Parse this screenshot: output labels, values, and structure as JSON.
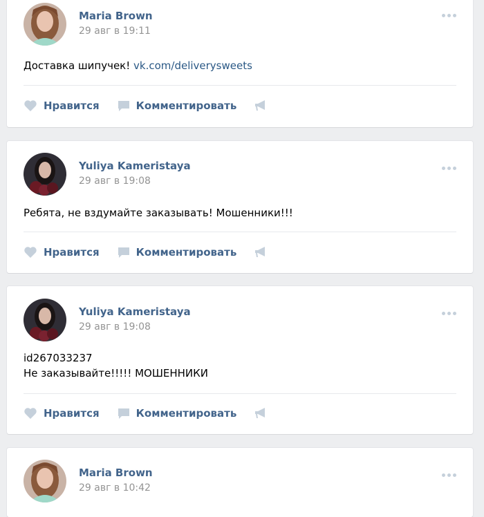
{
  "posts": [
    {
      "author": "Maria Brown",
      "date": "29 авг в 19:11",
      "text_lines": [
        "Доставка шипучек! "
      ],
      "link": "vk.com/deliverysweets",
      "avatar": "woman-blonde",
      "like_label": "Нравится",
      "comment_label": "Комментировать"
    },
    {
      "author": "Yuliya Kameristaya",
      "date": "29 авг в 19:08",
      "text_lines": [
        "Ребята, не вздумайте заказывать! Мошенники!!!"
      ],
      "avatar": "woman-dark",
      "like_label": "Нравится",
      "comment_label": "Комментировать"
    },
    {
      "author": "Yuliya Kameristaya",
      "date": "29 авг в 19:08",
      "text_lines": [
        "id267033237",
        "Не заказывайте!!!!! МОШЕННИКИ"
      ],
      "avatar": "woman-dark",
      "like_label": "Нравится",
      "comment_label": "Комментировать"
    },
    {
      "author": "Maria Brown",
      "date": "29 авг в 10:42",
      "avatar": "woman-blonde"
    }
  ],
  "icons": {
    "like": "heart-icon",
    "comment": "comment-icon",
    "share": "megaphone-icon",
    "more": "more-icon"
  },
  "colors": {
    "link": "#2a5885",
    "author": "#42648b",
    "icon": "#c5d0db",
    "meta": "#939393",
    "background": "#edeef0"
  }
}
